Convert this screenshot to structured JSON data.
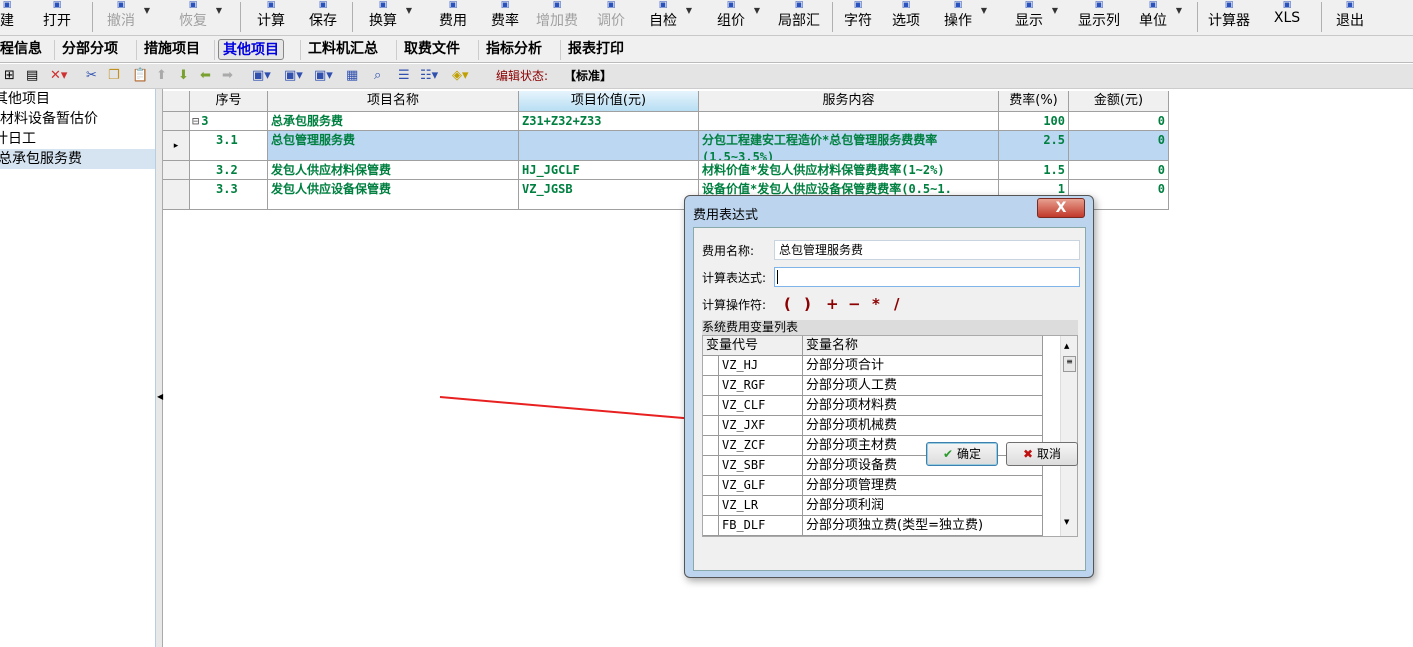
{
  "toolbar": {
    "items": [
      {
        "label": "建",
        "enabled": true
      },
      {
        "label": "打开",
        "enabled": true
      },
      {
        "label": "撤消",
        "enabled": false
      },
      {
        "label": "恢复",
        "enabled": false
      },
      {
        "label": "计算",
        "enabled": true
      },
      {
        "label": "保存",
        "enabled": true
      },
      {
        "label": "换算",
        "enabled": true
      },
      {
        "label": "费用",
        "enabled": true
      },
      {
        "label": "费率",
        "enabled": true
      },
      {
        "label": "增加费",
        "enabled": false
      },
      {
        "label": "调价",
        "enabled": false
      },
      {
        "label": "自检",
        "enabled": true
      },
      {
        "label": "组价",
        "enabled": true
      },
      {
        "label": "局部汇",
        "enabled": true
      },
      {
        "label": "字符",
        "enabled": true
      },
      {
        "label": "选项",
        "enabled": true
      },
      {
        "label": "操作",
        "enabled": true
      },
      {
        "label": "显示",
        "enabled": true
      },
      {
        "label": "显示列",
        "enabled": true
      },
      {
        "label": "单位",
        "enabled": true
      },
      {
        "label": "计算器",
        "enabled": true
      },
      {
        "label": "XLS",
        "enabled": true
      },
      {
        "label": "退出",
        "enabled": true
      }
    ]
  },
  "tabs": [
    "程信息",
    "分部分项",
    "措施项目",
    "其他项目",
    "工料机汇总",
    "取费文件",
    "指标分析",
    "报表打印"
  ],
  "active_tab": "其他项目",
  "edit_status": {
    "label": "编辑状态:",
    "value": "【标准】"
  },
  "tree": [
    "其他项目",
    "材料设备暂估价",
    "计日工",
    "总承包服务费"
  ],
  "grid": {
    "headers": [
      "序号",
      "项目名称",
      "项目价值(元)",
      "服务内容",
      "费率(%)",
      "金额(元)"
    ],
    "rows": [
      {
        "no": "3",
        "name": "总承包服务费",
        "value": "Z31+Z32+Z33",
        "service": "",
        "rate": "100",
        "amount": "0"
      },
      {
        "no": "3.1",
        "name": "总包管理服务费",
        "value": "",
        "service": "分包工程建安工程造价*总包管理服务费费率(1.5~3.5%)",
        "rate": "2.5",
        "amount": "0"
      },
      {
        "no": "3.2",
        "name": "发包人供应材料保管费",
        "value": "HJ_JGCLF",
        "service": "材料价值*发包人供应材料保管费费率(1~2%)",
        "rate": "1.5",
        "amount": "0"
      },
      {
        "no": "3.3",
        "name": "发包人供应设备保管费",
        "value": "VZ_JGSB",
        "service": "设备价值*发包人供应设备保管费费率(0.5~1.",
        "rate": "1",
        "amount": "0"
      }
    ]
  },
  "dialog": {
    "title": "费用表达式",
    "close": "X",
    "name_label": "费用名称:",
    "name_value": "总包管理服务费",
    "expr_label": "计算表达式:",
    "expr_value": "",
    "ops_label": "计算操作符:",
    "ops": [
      "(",
      ")",
      "+",
      "−",
      "*",
      "/"
    ],
    "list_title": "系统费用变量列表",
    "list_headers": [
      "变量代号",
      "变量名称"
    ],
    "vars": [
      [
        "VZ_HJ",
        "分部分项合计"
      ],
      [
        "VZ_RGF",
        "分部分项人工费"
      ],
      [
        "VZ_CLF",
        "分部分项材料费"
      ],
      [
        "VZ_JXF",
        "分部分项机械费"
      ],
      [
        "VZ_ZCF",
        "分部分项主材费"
      ],
      [
        "VZ_SBF",
        "分部分项设备费"
      ],
      [
        "VZ_GLF",
        "分部分项管理费"
      ],
      [
        "VZ_LR",
        "分部分项利润"
      ],
      [
        "FB_DLF",
        "分部分项独立费(类型=独立费)"
      ]
    ],
    "ok": "确定",
    "cancel": "取消"
  }
}
